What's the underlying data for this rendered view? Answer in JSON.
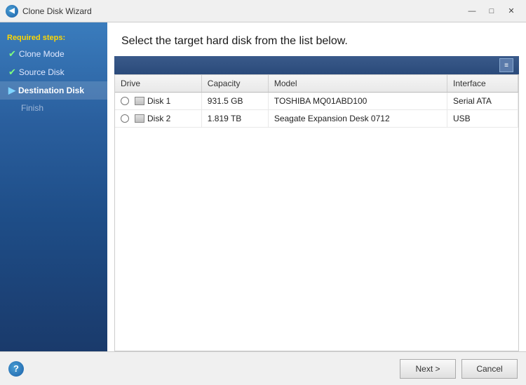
{
  "window": {
    "title": "Clone Disk Wizard",
    "controls": {
      "minimize": "—",
      "maximize": "□",
      "close": "✕"
    }
  },
  "sidebar": {
    "section_title": "Required steps:",
    "items": [
      {
        "id": "clone-mode",
        "label": "Clone Mode",
        "state": "done",
        "icon": "✔"
      },
      {
        "id": "source-disk",
        "label": "Source Disk",
        "state": "done",
        "icon": "✔"
      },
      {
        "id": "destination-disk",
        "label": "Destination Disk",
        "state": "active",
        "icon": "▶"
      },
      {
        "id": "finish",
        "label": "Finish",
        "state": "inactive",
        "icon": ""
      }
    ]
  },
  "content": {
    "heading": "Select the target hard disk from the list below.",
    "table": {
      "columns": [
        {
          "id": "drive",
          "label": "Drive"
        },
        {
          "id": "capacity",
          "label": "Capacity"
        },
        {
          "id": "model",
          "label": "Model"
        },
        {
          "id": "interface",
          "label": "Interface"
        }
      ],
      "rows": [
        {
          "drive": "Disk 1",
          "capacity": "931.5 GB",
          "model": "TOSHIBA MQ01ABD100",
          "interface": "Serial ATA"
        },
        {
          "drive": "Disk 2",
          "capacity": "1.819 TB",
          "model": "Seagate Expansion Desk 0712",
          "interface": "USB"
        }
      ]
    }
  },
  "buttons": {
    "next": "Next >",
    "cancel": "Cancel",
    "help": "?"
  }
}
